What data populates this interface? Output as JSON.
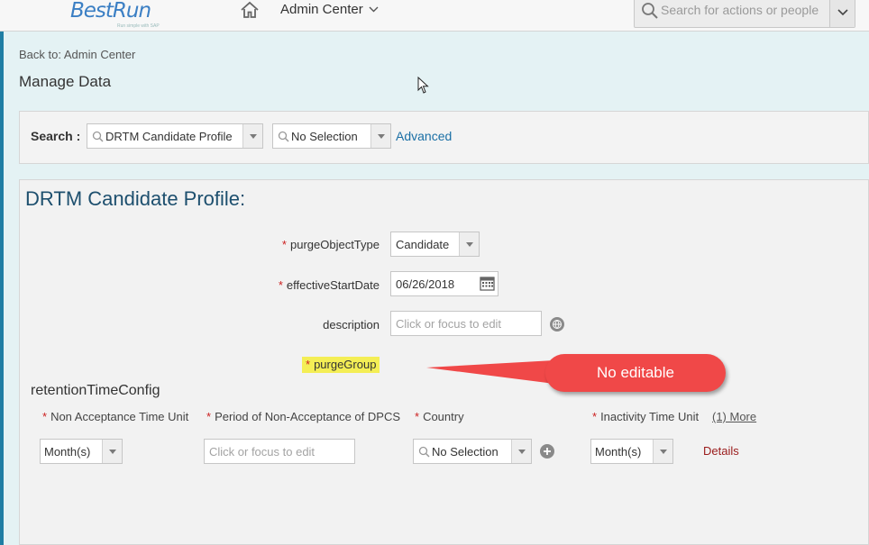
{
  "header": {
    "logo_text": "BestRun",
    "logo_tagline": "Run simple with SAP",
    "admin_menu_label": "Admin Center",
    "search_placeholder": "Search for actions or people"
  },
  "breadcrumb": {
    "back_label": "Back to: Admin Center"
  },
  "page_title": "Manage Data",
  "search_bar": {
    "label": "Search :",
    "object_value": "DRTM Candidate Profile",
    "selection_value": "No Selection",
    "advanced_label": "Advanced"
  },
  "profile": {
    "title": "DRTM Candidate Profile:",
    "purge_object_type": {
      "label": "purgeObjectType",
      "value": "Candidate"
    },
    "effective_start_date": {
      "label": "effectiveStartDate",
      "value": "06/26/2018"
    },
    "description": {
      "label": "description",
      "placeholder": "Click or focus to edit"
    },
    "purge_group": {
      "label": "purgeGroup"
    },
    "required_marker": "*"
  },
  "retention": {
    "section_title": "retentionTimeConfig",
    "columns": {
      "non_acceptance_unit": "Non Acceptance Time Unit",
      "period_non_acceptance": "Period of Non-Acceptance of DPCS",
      "country": "Country",
      "inactivity_unit": "Inactivity Time Unit"
    },
    "more_link": "(1) More",
    "values": {
      "non_acceptance_unit": "Month(s)",
      "period_placeholder": "Click or focus to edit",
      "country": "No Selection",
      "inactivity_unit": "Month(s)"
    },
    "details_link": "Details"
  },
  "callout": {
    "text": "No editable"
  },
  "colors": {
    "accent": "#1f7ea4",
    "callout": "#f04848",
    "highlight": "#f4ee55",
    "title": "#1d4f6e"
  }
}
